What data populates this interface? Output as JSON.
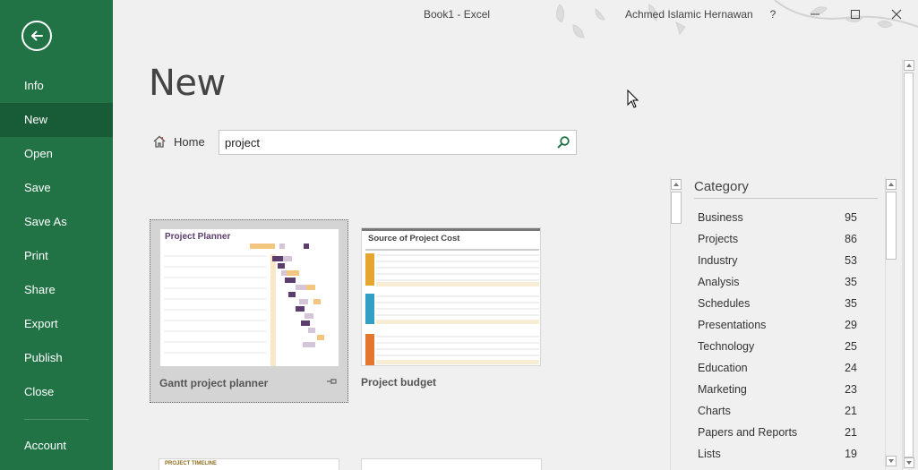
{
  "window": {
    "title": "Book1  -  Excel",
    "user": "Achmed Islamic Hernawan",
    "help": "?"
  },
  "sidebar": {
    "items": [
      {
        "label": "Info"
      },
      {
        "label": "New",
        "active": true
      },
      {
        "label": "Open"
      },
      {
        "label": "Save"
      },
      {
        "label": "Save As"
      },
      {
        "label": "Print"
      },
      {
        "label": "Share"
      },
      {
        "label": "Export"
      },
      {
        "label": "Publish"
      },
      {
        "label": "Close"
      }
    ],
    "account": "Account"
  },
  "main": {
    "heading": "New",
    "home_label": "Home",
    "search": {
      "value": "project",
      "placeholder": "Search for online templates"
    },
    "templates": [
      {
        "label": "Gantt project planner",
        "thumb_title": "Project Planner"
      },
      {
        "label": "Project budget",
        "thumb_title": "Source of Project Cost"
      },
      {
        "thumb_title": "PROJECT TIMELINE"
      }
    ]
  },
  "category": {
    "header": "Category",
    "items": [
      {
        "name": "Business",
        "count": "95"
      },
      {
        "name": "Projects",
        "count": "86"
      },
      {
        "name": "Industry",
        "count": "53"
      },
      {
        "name": "Analysis",
        "count": "35"
      },
      {
        "name": "Schedules",
        "count": "35"
      },
      {
        "name": "Presentations",
        "count": "29"
      },
      {
        "name": "Technology",
        "count": "25"
      },
      {
        "name": "Education",
        "count": "24"
      },
      {
        "name": "Marketing",
        "count": "23"
      },
      {
        "name": "Charts",
        "count": "21"
      },
      {
        "name": "Papers and Reports",
        "count": "21"
      },
      {
        "name": "Lists",
        "count": "19"
      }
    ]
  },
  "colors": {
    "accent": "#217346",
    "active": "#185c37"
  }
}
